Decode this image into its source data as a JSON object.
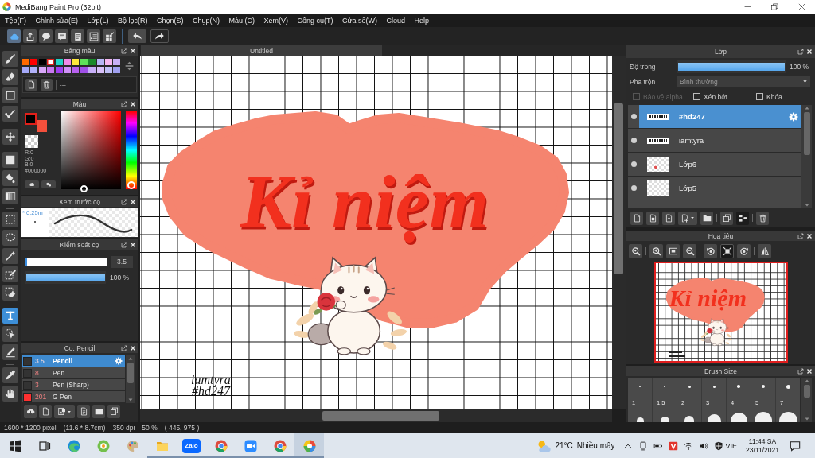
{
  "window": {
    "title": "MediBang Paint Pro (32bit)"
  },
  "menu": [
    "Tệp(F)",
    "Chỉnh sửa(E)",
    "Lớp(L)",
    "Bộ lọc(R)",
    "Chọn(S)",
    "Chụp(N)",
    "Màu (C)",
    "Xem(V)",
    "Công cụ(T)",
    "Cửa sổ(W)",
    "Cloud",
    "Help"
  ],
  "tool_groups": [
    {
      "tools": [
        {
          "kind": "brush",
          "selected": false
        },
        {
          "kind": "eraser",
          "selected": false
        },
        {
          "kind": "dot",
          "selected": false
        },
        {
          "kind": "line",
          "selected": false
        }
      ]
    },
    {
      "tools": [
        {
          "kind": "move",
          "selected": false
        }
      ]
    },
    {
      "tools": [
        {
          "kind": "fill_shape",
          "selected": false
        },
        {
          "kind": "bucket",
          "selected": false
        },
        {
          "kind": "gradient",
          "selected": false
        }
      ]
    },
    {
      "tools": [
        {
          "kind": "select_rect",
          "selected": false
        },
        {
          "kind": "lasso",
          "selected": false
        },
        {
          "kind": "magic_wand",
          "selected": false
        },
        {
          "kind": "select_pen",
          "selected": false
        },
        {
          "kind": "select_eraser",
          "selected": false
        }
      ]
    },
    {
      "tools": [
        {
          "kind": "text",
          "selected": true
        },
        {
          "kind": "operation",
          "selected": false
        },
        {
          "kind": "pen",
          "selected": false
        }
      ]
    },
    {
      "tools": [
        {
          "kind": "eyedropper",
          "selected": false
        },
        {
          "kind": "hand",
          "selected": false
        }
      ]
    }
  ],
  "palette": {
    "title": "Bảng màu",
    "swatches": [
      {
        "color": "#ff6a00",
        "selected": false
      },
      {
        "color": "#ff0000",
        "selected": false
      },
      {
        "color": "#000000",
        "selected": false
      },
      {
        "color": "#ffffff",
        "selected": true
      },
      {
        "color": "#22d3c5",
        "selected": false
      },
      {
        "color": "#f08ae8",
        "selected": false
      },
      {
        "color": "#ffe93c",
        "selected": false
      },
      {
        "color": "#5ee05a",
        "selected": false
      },
      {
        "color": "#1a8a2a",
        "selected": false
      },
      {
        "color": "#b7b7f5",
        "selected": false
      },
      {
        "color": "#f5b8f0",
        "selected": false
      },
      {
        "color": "#c8b0f5",
        "selected": false
      },
      {
        "color": "#a4a8f8",
        "selected": false
      },
      {
        "color": "#b0b0f8",
        "selected": false
      },
      {
        "color": "#d8a8f8",
        "selected": false
      },
      {
        "color": "#c878f0",
        "selected": false
      },
      {
        "color": "#a040f0",
        "selected": false
      },
      {
        "color": "#d090f8",
        "selected": false
      },
      {
        "color": "#b860f0",
        "selected": false
      },
      {
        "color": "#a050e8",
        "selected": false
      },
      {
        "color": "#c8b0f8",
        "selected": false
      },
      {
        "color": "#d8c0f8",
        "selected": false
      },
      {
        "color": "#c0c0f8",
        "selected": false
      },
      {
        "color": "#a0a0f0",
        "selected": false
      }
    ],
    "palette_name": "---"
  },
  "color_panel": {
    "title": "Màu",
    "swatches": [
      {
        "kind": "foreground",
        "color": "#000000"
      },
      {
        "kind": "background",
        "color": "#f4503c"
      }
    ],
    "readouts": [
      "R:0",
      "G:0",
      "B:0",
      "#000000"
    ],
    "hue_slider": {
      "level": 0
    }
  },
  "brush_preview": {
    "title": "Xem trước cọ",
    "size": "* 0.25m"
  },
  "brush_control": {
    "title": "Kiểm soát cọ",
    "sliders": [
      {
        "kind": "size",
        "level": 0.02,
        "reading": "3.5"
      },
      {
        "kind": "opacity",
        "level": 1,
        "reading": "100 %"
      }
    ]
  },
  "brushes": {
    "title": "Cọ: Pencil",
    "items": [
      {
        "color": "#333333",
        "size": "3.5",
        "name": "Pencil",
        "selected": true
      },
      {
        "color": "#333333",
        "size": "8",
        "name": "Pen",
        "selected": false
      },
      {
        "color": "#333333",
        "size": "3",
        "name": "Pen (Sharp)",
        "selected": false
      },
      {
        "color": "#ff3030",
        "size": "201",
        "name": "G Pen",
        "selected": false
      }
    ]
  },
  "canvas": {
    "tab": "Untitled",
    "heading": "Kỉ niệm",
    "signature": [
      "iamtyra",
      "#hd247"
    ]
  },
  "layers_panel": {
    "title": "Lớp",
    "opacity": {
      "label": "Độ trong",
      "level": 1,
      "reading": "100 %"
    },
    "blend": {
      "label": "Pha trộn",
      "value": "Bình thường"
    },
    "options": [
      {
        "label": "Bảo vệ alpha",
        "checked": false,
        "disabled": true
      },
      {
        "label": "Xén bớt",
        "checked": false,
        "disabled": false
      },
      {
        "label": "Khóa",
        "checked": false,
        "disabled": false
      }
    ],
    "layers": [
      {
        "kind": "text",
        "name": "#hd247",
        "visible": true,
        "selected": true
      },
      {
        "kind": "text",
        "name": "iamtyra",
        "visible": true,
        "selected": false
      },
      {
        "kind": "sketch",
        "name": "Lớp6",
        "visible": true,
        "selected": false
      },
      {
        "kind": "empty",
        "name": "Lớp5",
        "visible": true,
        "selected": false
      }
    ]
  },
  "navigator": {
    "title": "Hoa tiêu",
    "tools": [
      {
        "kind": "zoom",
        "selected": false
      },
      {
        "kind": "zoom_in",
        "selected": false
      },
      {
        "kind": "fit",
        "selected": false
      },
      {
        "kind": "zoom_out",
        "selected": false
      },
      {
        "kind": "rotate_left",
        "selected": false
      },
      {
        "kind": "reset",
        "selected": true
      },
      {
        "kind": "rotate_right",
        "selected": false
      },
      {
        "kind": "flip",
        "selected": false
      }
    ],
    "preview_heading": "Kỉ niệm"
  },
  "brush_size": {
    "title": "Brush Size",
    "sizes": [
      "1",
      "1.5",
      "2",
      "3",
      "4",
      "5",
      "7"
    ]
  },
  "status_bar": [
    "1600 * 1200 pixel",
    "(11.6 * 8.7cm)",
    "350 dpi",
    "50 %",
    "( 445, 975 )"
  ],
  "taskbar": {
    "apps": [
      {
        "kind": "start",
        "running": false,
        "selected": false
      },
      {
        "kind": "task_view",
        "running": false,
        "selected": false
      },
      {
        "kind": "browser_swirl",
        "running": false,
        "selected": false
      },
      {
        "kind": "green_app",
        "running": false,
        "selected": false
      },
      {
        "kind": "paint_app",
        "running": false,
        "selected": false
      },
      {
        "kind": "folder",
        "running": true,
        "selected": false
      },
      {
        "kind": "chat",
        "label": "Zalo",
        "running": true,
        "selected": false
      },
      {
        "kind": "tricolor_browser",
        "running": true,
        "selected": false
      },
      {
        "kind": "video_camera",
        "running": true,
        "selected": false
      },
      {
        "kind": "tricolor_browser",
        "running": true,
        "selected": false
      },
      {
        "kind": "color_wheel",
        "running": true,
        "selected": true
      }
    ],
    "weather": {
      "temperature": "21°C",
      "condition": "Nhiều mây"
    },
    "language": "VIE",
    "time": "11:44 SA",
    "date": "23/11/2021"
  }
}
